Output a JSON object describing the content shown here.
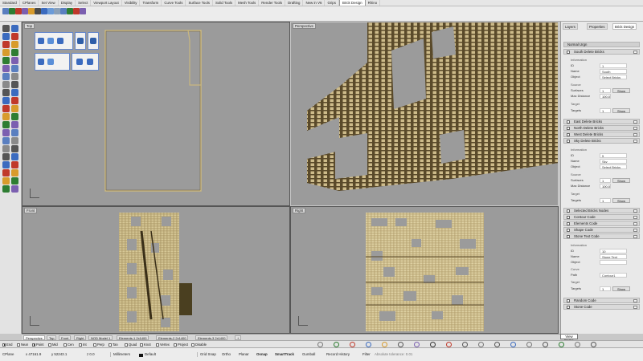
{
  "ribbon_tabs": [
    "Standard",
    "CPlanes",
    "Set View",
    "Display",
    "Select",
    "Viewport Layout",
    "Visibility",
    "Transform",
    "Curve Tools",
    "Surface Tools",
    "Solid Tools",
    "Mesh Tools",
    "Render Tools",
    "Drafting",
    "New in V6",
    "Grips",
    "Brick Design",
    "Rhino"
  ],
  "active_ribbon_tab": "Brick Design",
  "viewports": {
    "top": "Top",
    "perspective": "Perspective",
    "front": "Front",
    "right": "Right"
  },
  "right_panel": {
    "tabs": [
      "Layers",
      "Properties",
      "Brick Design"
    ],
    "header": "Normal Urgn",
    "sections": [
      {
        "label": "South Delete Bricks",
        "checked": true
      },
      {
        "label": "East Delete Bricks",
        "checked": true
      },
      {
        "label": "North Delete Bricks",
        "checked": true
      },
      {
        "label": "West Delete Bricks",
        "checked": true
      },
      {
        "label": "Sky Delete Bricks",
        "checked": true
      },
      {
        "label": "Selected Bricks Nodes",
        "checked": true
      },
      {
        "label": "Contour Code",
        "checked": true
      },
      {
        "label": "Elements Code",
        "checked": true
      },
      {
        "label": "Shape Code",
        "checked": true
      },
      {
        "label": "Stone Text Code",
        "checked": true
      },
      {
        "label": "Random Code",
        "checked": true
      },
      {
        "label": "Stone Code",
        "checked": true
      }
    ],
    "group1": {
      "information": "Information",
      "id_label": "ID",
      "id_value": "1",
      "name_label": "Name",
      "name_value": "South",
      "object_label": "Object",
      "object_value": "Select Bricks",
      "source": "Source",
      "surfaces_label": "Surfaces",
      "surfaces_value": "1",
      "max_distance_label": "Max Distance",
      "max_distance_value": "100.0",
      "target": "Target",
      "targets_label": "Targets",
      "targets_value": "1",
      "show_label": "Show"
    },
    "group2": {
      "information": "Information",
      "id_label": "ID",
      "id_value": "5",
      "name_label": "Name",
      "name_value": "Sky",
      "object_label": "Object",
      "object_value": "Select Bricks",
      "source": "Source",
      "surfaces_label": "Surfaces",
      "surfaces_value": "1",
      "max_distance_label": "Max Distance",
      "max_distance_value": "100.0",
      "target": "Target",
      "targets_label": "Targets",
      "targets_value": "1",
      "show_label": "Show"
    },
    "group3": {
      "information": "Information",
      "id_label": "ID",
      "id_value": "10",
      "name_label": "Name",
      "name_value": "Stone Text",
      "object_label": "Object",
      "object_value": "",
      "curve": "Curve",
      "path_label": "Path",
      "path_value": "Contour1",
      "target": "Target",
      "targets_label": "Targets",
      "targets_value": "1",
      "show_label": "Show"
    }
  },
  "view_name_tag": "View Name",
  "viewport_tabs": [
    "Perspective",
    "Top",
    "Front",
    "Right",
    "NOD Model 1",
    "Elements-1 2x1400",
    "Elements-2 2x1400",
    "Elements-3 2x1400"
  ],
  "active_viewport_tab": "Perspective",
  "osnaps": [
    {
      "label": "End",
      "on": true
    },
    {
      "label": "Near",
      "on": false
    },
    {
      "label": "Point",
      "on": true
    },
    {
      "label": "Mid",
      "on": false
    },
    {
      "label": "Cen",
      "on": false
    },
    {
      "label": "Int",
      "on": false
    },
    {
      "label": "Perp",
      "on": false
    },
    {
      "label": "Tan",
      "on": false
    },
    {
      "label": "Quad",
      "on": false
    },
    {
      "label": "Knot",
      "on": false
    },
    {
      "label": "Vertex",
      "on": false
    },
    {
      "label": "Project",
      "on": false
    },
    {
      "label": "Disable",
      "on": false
    }
  ],
  "status_bar": {
    "cplane": "CPlane",
    "x": "x 47161.9",
    "y": "y 52243.1",
    "z": "z 0.0",
    "units": "Millimeters",
    "layer": "Default",
    "grid_snap": "Grid Snap",
    "ortho": "Ortho",
    "planar": "Planar",
    "osnap": "Osnap",
    "smarttrack": "SmartTrack",
    "gumball": "Gumball",
    "record_history": "Record History",
    "filter": "Filter",
    "tolerance": "Absolute tolerance: 0.01"
  },
  "colors": {
    "brick": "#cdbb8a",
    "brick_dark": "#5a4a2a",
    "viewport_bg": "#9b9b9b",
    "active_tab": "#ffffff",
    "layer_swatch": "#111111"
  }
}
